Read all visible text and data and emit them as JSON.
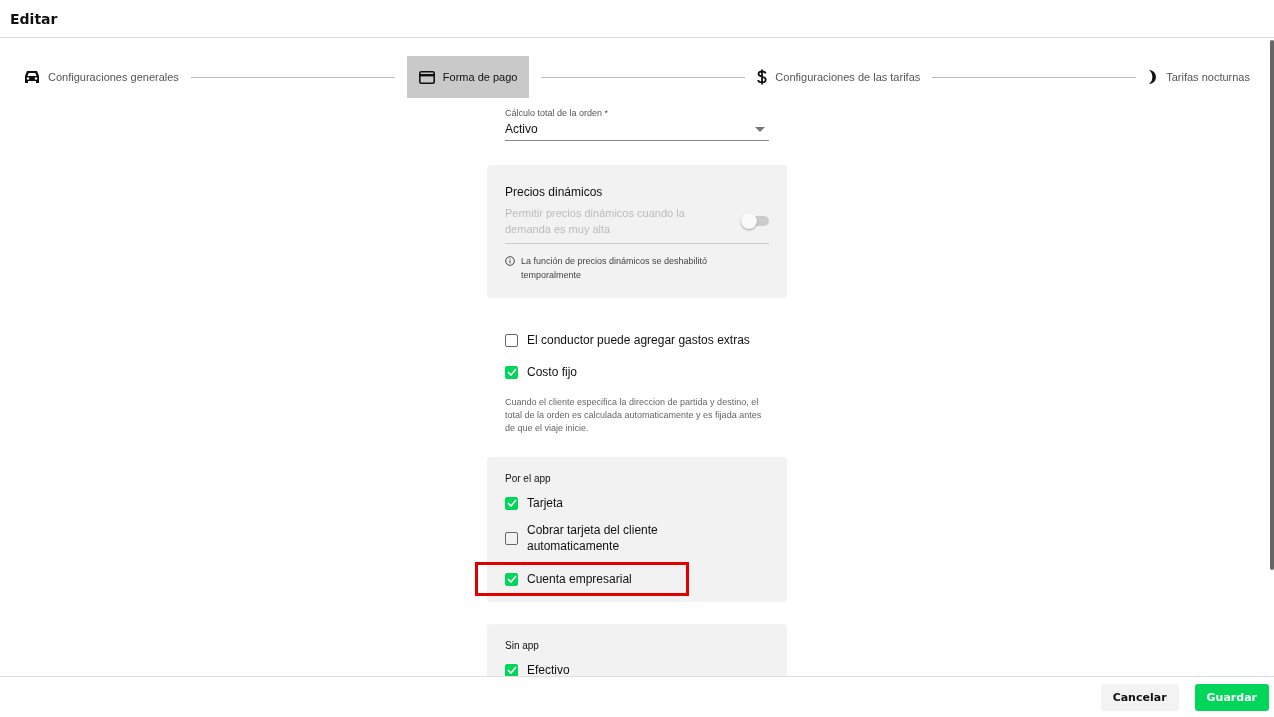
{
  "window": {
    "title": "Editar"
  },
  "steps": [
    {
      "label": "Configuraciones generales",
      "kind": "car",
      "selected": false
    },
    {
      "label": "Forma de pago",
      "kind": "card",
      "selected": true
    },
    {
      "label": "Configuraciones de las tarifas",
      "kind": "dollar",
      "selected": false
    },
    {
      "label": "Tarifas nocturnas",
      "kind": "moon",
      "selected": false
    }
  ],
  "order_total": {
    "label": "Cálculo total de la orden *",
    "value": "Activo"
  },
  "dynamic_pricing": {
    "title": "Precios dinámicos",
    "label": "Permitir precios dinámicos cuando la demanda es muy alta",
    "on": false,
    "disabled": true,
    "note": "La función de precios dinámicos se deshabilitó temporalmente"
  },
  "options": [
    {
      "label": "El conductor puede agregar gastos extras",
      "checked": false
    },
    {
      "label": "Costo fijo",
      "checked": true
    }
  ],
  "fixed_cost_note": "Cuando el cliente especifica la direccion de partida y destino, el total de la orden es calculada automaticamente y es fijada antes de que el viaje inicie.",
  "groups": [
    {
      "title": "Por el app",
      "items": [
        {
          "label": "Tarjeta",
          "checked": true,
          "highlighted": false
        },
        {
          "label": "Cobrar tarjeta del cliente automaticamente",
          "checked": false,
          "highlighted": false
        },
        {
          "label": "Cuenta empresarial",
          "checked": true,
          "highlighted": true
        }
      ]
    },
    {
      "title": "Sin app",
      "items": [
        {
          "label": "Efectivo",
          "checked": true,
          "highlighted": false
        }
      ]
    }
  ],
  "buttons": [
    {
      "label": "Cancelar",
      "kind": "secondary"
    },
    {
      "label": "Guardar",
      "kind": "primary"
    }
  ]
}
